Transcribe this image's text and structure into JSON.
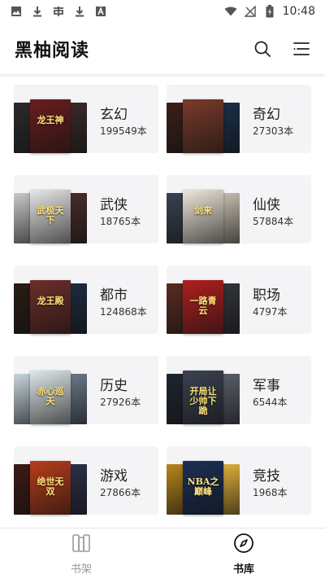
{
  "status_bar": {
    "time": "10:48",
    "left_icons": [
      "image-icon",
      "download-icon",
      "app-icon",
      "download-icon",
      "font-icon"
    ],
    "right_icons": [
      "wifi-icon",
      "no-signal-icon",
      "battery-charging-icon"
    ]
  },
  "app_bar": {
    "title": "黑柚阅读",
    "actions": [
      "search-icon",
      "menu-list-icon"
    ]
  },
  "categories": [
    {
      "name": "玄幻",
      "count": "199549本",
      "cover_text": "龙王神",
      "colors": [
        "#2b2b2b",
        "#6b1d1d",
        "#3a2a2a"
      ]
    },
    {
      "name": "奇幻",
      "count": "27303本",
      "cover_text": "",
      "colors": [
        "#3b1f16",
        "#7a3b2a",
        "#1a2f4a"
      ]
    },
    {
      "name": "武侠",
      "count": "18765本",
      "cover_text": "武极天下",
      "colors": [
        "#c9c9c9",
        "#e8e8e8",
        "#4a2b2b"
      ]
    },
    {
      "name": "仙侠",
      "count": "57884本",
      "cover_text": "剑来",
      "colors": [
        "#394253",
        "#efe7dc",
        "#c8c0b0"
      ]
    },
    {
      "name": "都市",
      "count": "124868本",
      "cover_text": "龙王殿",
      "colors": [
        "#2a1b15",
        "#6d2e2a",
        "#1d2b3f"
      ]
    },
    {
      "name": "职场",
      "count": "4797本",
      "cover_text": "一路青云",
      "colors": [
        "#5a2b1f",
        "#b21f1f",
        "#33343a"
      ]
    },
    {
      "name": "历史",
      "count": "27926本",
      "cover_text": "赤心巡天",
      "colors": [
        "#c6d6dd",
        "#dfe8ea",
        "#6b7a8a"
      ]
    },
    {
      "name": "军事",
      "count": "6544本",
      "cover_text": "开局让少帅下跪",
      "colors": [
        "#1f2631",
        "#3b4250",
        "#5a5f6a"
      ]
    },
    {
      "name": "游戏",
      "count": "27866本",
      "cover_text": "绝世无双",
      "colors": [
        "#3b1a14",
        "#b83d1b",
        "#2c2f4a"
      ]
    },
    {
      "name": "竞技",
      "count": "1968本",
      "cover_text": "NBA之巅峰",
      "colors": [
        "#b8861c",
        "#1b2f55",
        "#e2b23a"
      ]
    }
  ],
  "bottom_nav": [
    {
      "label": "书架",
      "icon": "bookshelf-icon",
      "active": false
    },
    {
      "label": "书库",
      "icon": "compass-icon",
      "active": true
    }
  ]
}
